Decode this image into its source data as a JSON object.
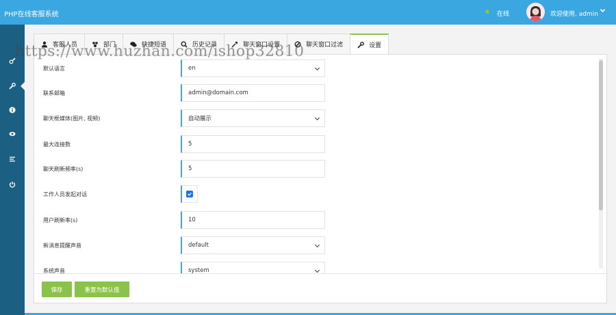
{
  "header": {
    "app_title": "PHP在线客服系统",
    "status": "在线",
    "welcome": "欢迎使用, admin",
    "colors": {
      "bar": "#3aa7e1",
      "status_dot": "#8bc34a"
    }
  },
  "sidebar": {
    "items": [
      {
        "icon": "key-icon"
      },
      {
        "icon": "wrench-icon",
        "active": true
      },
      {
        "icon": "info-icon"
      },
      {
        "icon": "eye-icon"
      },
      {
        "icon": "list-icon"
      },
      {
        "icon": "power-icon"
      }
    ],
    "color": "#1b5f83"
  },
  "tabs": [
    {
      "label": "客服人员",
      "icon": "user-icon"
    },
    {
      "label": "部门",
      "icon": "group-icon"
    },
    {
      "label": "快捷短语",
      "icon": "comments-icon"
    },
    {
      "label": "历史记录",
      "icon": "search-icon"
    },
    {
      "label": "聊天窗口设置",
      "icon": "eyedropper-icon"
    },
    {
      "label": "聊天窗口过滤",
      "icon": "ban-icon"
    },
    {
      "label": "设置",
      "icon": "wrench-icon",
      "active": true
    }
  ],
  "form": {
    "default_language": {
      "label": "默认语言",
      "value": "en"
    },
    "contact_email": {
      "label": "联系邮箱",
      "value": "admin@domain.com"
    },
    "chat_media": {
      "label": "聊天框媒体(图片, 视频)",
      "value": "自动展示"
    },
    "max_connections": {
      "label": "最大连接数",
      "value": "5"
    },
    "chat_refresh": {
      "label": "聊天刷新频率(s)",
      "value": "5"
    },
    "staff_initiate": {
      "label": "工作人员发起对话",
      "checked": true
    },
    "user_refresh": {
      "label": "用户刷新率(s)",
      "value": "10"
    },
    "new_message_sound": {
      "label": "新消息提醒声音",
      "value": "default"
    },
    "system_sound": {
      "label": "系统声音",
      "value": "system"
    }
  },
  "buttons": {
    "save": "保存",
    "reset": "重置为默认值",
    "color": "#8bc34a"
  },
  "watermark": "https://www.huzhan.com/ishop32810"
}
